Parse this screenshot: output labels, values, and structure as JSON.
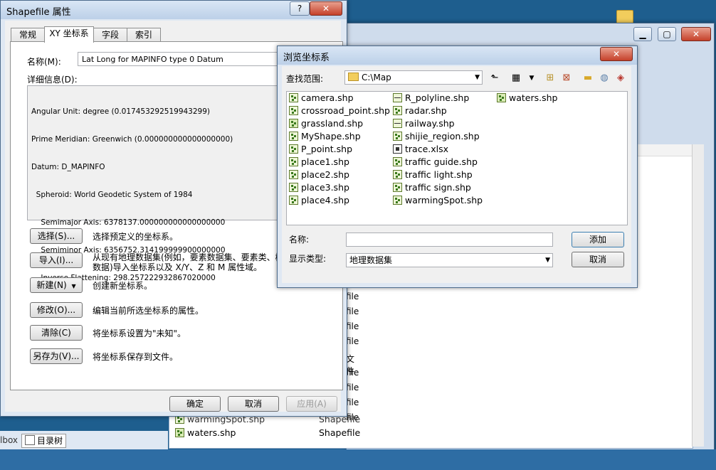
{
  "props": {
    "title": "Shapefile 属性",
    "help_btn": "?",
    "close_btn": "✕",
    "tabs": [
      "常规",
      "XY 坐标系",
      "字段",
      "索引"
    ],
    "name_label": "名称(M):",
    "name_value": "Lat Long for MAPINFO type 0 Datum",
    "details_label": "详细信息(D):",
    "details": [
      "Angular Unit: degree (0.017453292519943299)",
      "Prime Meridian: Greenwich (0.000000000000000000)",
      "Datum: D_MAPINFO",
      "  Spheroid: World Geodetic System of 1984",
      "    Semimajor Axis: 6378137.000000000000000000",
      "    Semiminor Axis: 6356752.314199999900000000",
      "    Inverse Flattening: 298.257222932867020000"
    ],
    "actions": [
      {
        "btn": "选择(S)...",
        "desc": "选择预定义的坐标系。"
      },
      {
        "btn": "导入(I)...",
        "desc": "从现有地理数据集(例如，要素数据集、要素类、栅"
      },
      {
        "btn": "新建(N)",
        "desc": "创建新坐标系。"
      },
      {
        "btn": "修改(O)...",
        "desc": "编辑当前所选坐标系的属性。"
      },
      {
        "btn": "清除(C)",
        "desc": "将坐标系设置为\"未知\"。"
      },
      {
        "btn": "另存为(V)...",
        "desc": "将坐标系保存到文件。"
      }
    ],
    "import_desc_line2": "数据)导入坐标系以及 X/Y、Z 和 M 属性域。",
    "ok": "确定",
    "cancel": "取消",
    "apply": "应用(A)"
  },
  "browse": {
    "title": "浏览坐标系",
    "close_btn": "✕",
    "lookin_label": "查找范围:",
    "lookin_value": "C:\\Map",
    "files_col1": [
      "camera.shp",
      "crossroad_point.shp",
      "grassland.shp",
      "MyShape.shp",
      "P_point.shp",
      "place1.shp",
      "place2.shp",
      "place3.shp",
      "place4.shp"
    ],
    "files_col2": [
      "R_polyline.shp",
      "radar.shp",
      "railway.shp",
      "shijie_region.shp",
      "trace.xlsx",
      "traffic guide.shp",
      "traffic light.shp",
      "traffic sign.shp",
      "warmingSpot.shp"
    ],
    "files_col3": [
      "waters.shp"
    ],
    "name_label": "名称:",
    "name_value": "",
    "type_label": "显示类型:",
    "type_value": "地理数据集",
    "add_btn": "添加",
    "cancel_btn": "取消"
  },
  "back": {
    "file_rows": [
      "file",
      "file",
      "file",
      "file",
      "文件",
      "file",
      "file",
      "file",
      "file"
    ],
    "row_warming_name": "warmingSpot.shp",
    "row_warming_type": "Shapefile",
    "row_waters_name": "waters.shp",
    "row_waters_type": "Shapefile",
    "toolbox_tab": "lbox",
    "catalog_tab": "目录树"
  }
}
